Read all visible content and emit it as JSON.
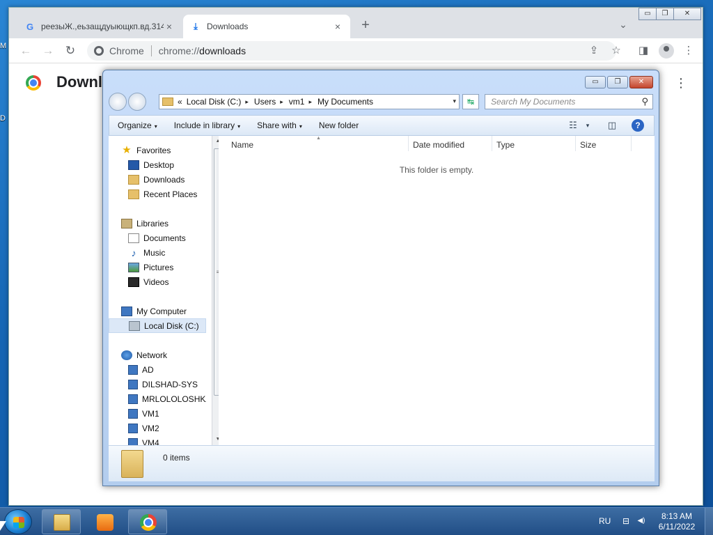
{
  "desktop": {
    "edge_label_1": "M",
    "edge_label_2": "D"
  },
  "chrome": {
    "tabs": [
      {
        "favicon": "G",
        "title": "реезыЖ.,еьзащдуыющкп.вд.314",
        "close": "×"
      },
      {
        "favicon": "⤓",
        "title": "Downloads",
        "close": "×"
      }
    ],
    "new_tab": "+",
    "tab_search": "⌄",
    "window_controls": {
      "minimize": "▭",
      "restore": "❐",
      "close": "✕"
    },
    "toolbar": {
      "back": "←",
      "forward": "→",
      "reload": "↻",
      "site_chip": "Chrome",
      "url_scheme": "chrome://",
      "url_host": "downloads",
      "share": "⇪",
      "bookmark": "☆",
      "side_panel": "◨",
      "menu": "⋮"
    },
    "page": {
      "title": "Downloads",
      "menu": "⋮"
    }
  },
  "explorer": {
    "window_controls": {
      "minimize": "▭",
      "maximize": "❐",
      "close": "✕"
    },
    "address": {
      "overflow": "«",
      "crumbs": [
        "Local Disk (C:)",
        "Users",
        "vm1",
        "My Documents"
      ],
      "separator": "▸",
      "dropdown": "▾"
    },
    "refresh": "↹",
    "search_placeholder": "Search My Documents",
    "search_icon": "⚲",
    "commands": {
      "organize": "Organize",
      "include_in_library": "Include in library",
      "share_with": "Share with",
      "new_folder": "New folder",
      "caret": "▾",
      "view_icon": "☷",
      "view_caret": "▾",
      "preview_icon": "◫",
      "help": "?"
    },
    "nav": {
      "favorites": {
        "label": "Favorites",
        "items": [
          "Desktop",
          "Downloads",
          "Recent Places"
        ]
      },
      "libraries": {
        "label": "Libraries",
        "items": [
          "Documents",
          "Music",
          "Pictures",
          "Videos"
        ]
      },
      "computer": {
        "label": "My Computer",
        "items": [
          "Local Disk (C:)"
        ]
      },
      "network": {
        "label": "Network",
        "items": [
          "AD",
          "DILSHAD-SYS",
          "MRLOLOLOSHKA",
          "VM1",
          "VM2",
          "VM4"
        ]
      },
      "selected": "Local Disk (C:)"
    },
    "scrollbar": {
      "up": "▲",
      "down": "▼",
      "grip": "≡"
    },
    "columns": {
      "name": "Name",
      "date_modified": "Date modified",
      "type": "Type",
      "size": "Size",
      "sort_indicator": "▲"
    },
    "empty_message": "This folder is empty.",
    "details": {
      "items_count": "0 items"
    }
  },
  "taskbar": {
    "language": "RU",
    "network_icon": "⊟",
    "volume_icon": "◀)",
    "time": "8:13 AM",
    "date": "6/11/2022"
  }
}
